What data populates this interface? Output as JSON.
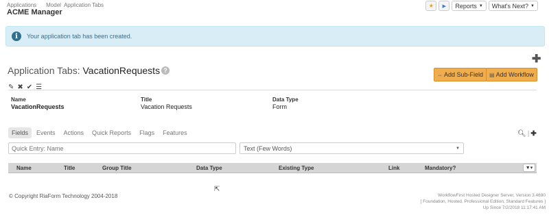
{
  "breadcrumb": [
    "Applications",
    "Model",
    "Application Tabs"
  ],
  "app_name": "ACME Manager",
  "top_buttons": {
    "reports": "Reports",
    "whats_next": "What's Next?"
  },
  "alert": "Your application tab has been created.",
  "page_title": {
    "prefix": "Application Tabs:",
    "name": "VacationRequests"
  },
  "buttons": {
    "add_subfield": "Add Sub-Field",
    "add_workflow": "Add Workflow"
  },
  "details": {
    "name_label": "Name",
    "name_value": "VacationRequests",
    "title_label": "Title",
    "title_value": "Vacation Requests",
    "type_label": "Data Type",
    "type_value": "Form"
  },
  "tabs": [
    "Fields",
    "Events",
    "Actions",
    "Quick Reports",
    "Flags",
    "Features"
  ],
  "quick_entry_placeholder": "Quick Entry: Name",
  "type_select": "Text (Few Words)",
  "columns": [
    "Name",
    "Title",
    "Group Title",
    "Data Type",
    "Existing Type",
    "Link",
    "Mandatory?"
  ],
  "footer": {
    "copyright": "© Copyright RiaForm Technology 2004-2018",
    "server_line1": "WorkflowFirst Hosted Designer Server, Version 3.4690",
    "server_line2": "[ Foundation, Hosted, Professional Edition, Standard Features ]",
    "server_line3": "Up Since 7/2/2018 11:17:41 AM"
  }
}
